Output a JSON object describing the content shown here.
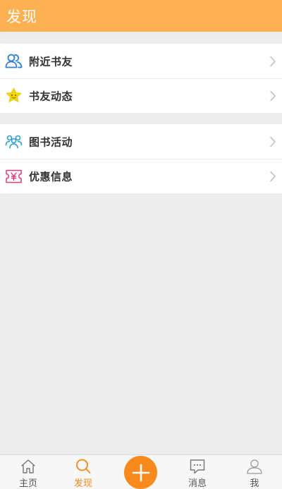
{
  "header": {
    "title": "发现"
  },
  "groups": [
    {
      "items": [
        {
          "label": "附近书友",
          "icon": "people-icon"
        },
        {
          "label": "书友动态",
          "icon": "star-face-icon"
        }
      ]
    },
    {
      "items": [
        {
          "label": "图书活动",
          "icon": "group-activity-icon"
        },
        {
          "label": "优惠信息",
          "icon": "yen-ticket-icon"
        }
      ]
    }
  ],
  "tabbar": {
    "active": "发现",
    "tabs": [
      {
        "label": "主页",
        "icon": "home-icon"
      },
      {
        "label": "发现",
        "icon": "search-icon"
      },
      {
        "label": "",
        "icon": "plus-icon"
      },
      {
        "label": "消息",
        "icon": "chat-icon"
      },
      {
        "label": "我",
        "icon": "user-icon"
      }
    ]
  },
  "colors": {
    "header_bg": "#fdb152",
    "accent": "#f8891c",
    "background": "#ececec",
    "people_icon": "#2f7fd8",
    "star_icon": "#f5d800",
    "activity_icon": "#2aa0d0",
    "ticket_icon": "#e03a78"
  }
}
